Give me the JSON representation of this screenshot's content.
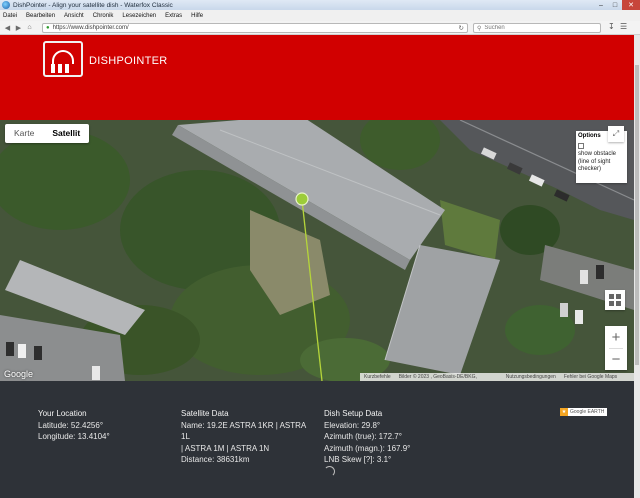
{
  "window": {
    "title": "DishPointer - Align your satellite dish - Waterfox Classic"
  },
  "menubar": {
    "items": [
      "Datei",
      "Bearbeiten",
      "Ansicht",
      "Chronik",
      "Lesezeichen",
      "Extras",
      "Hilfe"
    ]
  },
  "navbar": {
    "url": "https://www.dishpointer.com/",
    "search_placeholder": "Suchen"
  },
  "site": {
    "brand": "DISHPOINTER"
  },
  "map": {
    "type_tabs": [
      "Karte",
      "Satellit"
    ],
    "active_tab": "Satellit",
    "options_title": "Options",
    "options_obstacle_label": "show obstacle (line of sight checker)",
    "options_obstacle_checked": false,
    "google_logo": "Google",
    "attribution": {
      "shortcuts": "Kurzbefehle",
      "imagery": "Bilder © 2023 , GeoBasis-DE/BKG, GeoContent",
      "terms": "Nutzungsbedingungen",
      "report": "Fehler bei Google Maps melden"
    },
    "colors": {
      "marker": "#9ccc3a",
      "line": "#b5d53a"
    }
  },
  "info": {
    "location": {
      "heading": "Your Location",
      "latitude": "Latitude: 52.4256°",
      "longitude": "Longitude: 13.4104°"
    },
    "satellite": {
      "heading": "Satellite Data",
      "name_line1": "Name: 19.2E ASTRA 1KR | ASTRA 1L",
      "name_line2": "| ASTRA 1M | ASTRA 1N",
      "distance": "Distance: 38631km"
    },
    "setup": {
      "heading": "Dish Setup Data",
      "elevation": "Elevation: 29.8°",
      "azimuth_true": "Azimuth (true): 172.7°",
      "azimuth_magn": "Azimuth (magn.): 167.9°",
      "lnb_skew": "LNB Skew [?]: 3.1°"
    },
    "badge": {
      "text": "Google EARTH"
    }
  },
  "colors": {
    "header_red": "#d10000",
    "footer_bg": "#2e3238"
  }
}
